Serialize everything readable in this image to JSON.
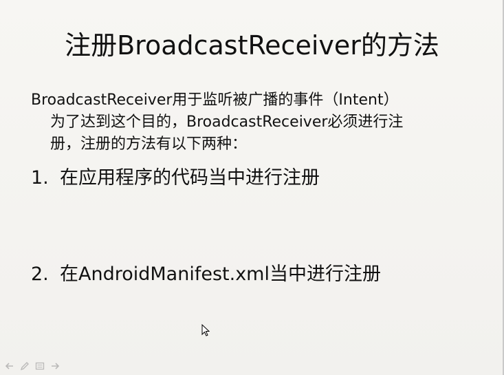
{
  "slide": {
    "title": "注册BroadcastReceiver的方法",
    "intro_lines": [
      "BroadcastReceiver用于监听被广播的事件（Intent）",
      "为了达到这个目的，BroadcastReceiver必须进行注",
      "册，注册的方法有以下两种："
    ],
    "items": [
      {
        "number": "1.",
        "text": "在应用程序的代码当中进行注册"
      },
      {
        "number": "2.",
        "text": "在AndroidManifest.xml当中进行注册"
      }
    ]
  },
  "toolbar": {
    "icons": [
      "back-arrow-icon",
      "pen-icon",
      "slides-menu-icon",
      "next-arrow-icon"
    ]
  },
  "colors": {
    "background": "#f3f2ef",
    "text": "#111111"
  }
}
